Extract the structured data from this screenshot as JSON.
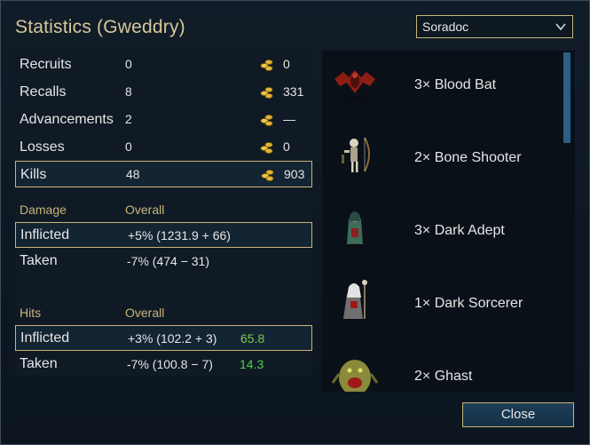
{
  "dialog": {
    "title": "Statistics (Gweddry)",
    "side_select": {
      "value": "Soradoc"
    },
    "close_label": "Close"
  },
  "summary": [
    {
      "label": "Recruits",
      "value": "0",
      "gold": "0"
    },
    {
      "label": "Recalls",
      "value": "8",
      "gold": "331"
    },
    {
      "label": "Advancements",
      "value": "2",
      "gold": "—"
    },
    {
      "label": "Losses",
      "value": "0",
      "gold": "0"
    },
    {
      "label": "Kills",
      "value": "48",
      "gold": "903"
    }
  ],
  "damage": {
    "header": "Damage",
    "column": "Overall",
    "inflicted": {
      "label": "Inflicted",
      "value": "+5% (1231.9 + 66)"
    },
    "taken": {
      "label": "Taken",
      "value": "-7% (474 − 31)"
    }
  },
  "hits": {
    "header": "Hits",
    "column": "Overall",
    "inflicted": {
      "label": "Inflicted",
      "value": "+3% (102.2 + 3)",
      "pct": "65.8"
    },
    "taken": {
      "label": "Taken",
      "value": "-7% (100.8 − 7)",
      "pct": "14.3"
    }
  },
  "units": [
    {
      "label": "3× Blood Bat",
      "icon": "blood-bat-sprite"
    },
    {
      "label": "2× Bone Shooter",
      "icon": "bone-shooter-sprite"
    },
    {
      "label": "3× Dark Adept",
      "icon": "dark-adept-sprite"
    },
    {
      "label": "1× Dark Sorcerer",
      "icon": "dark-sorcerer-sprite"
    },
    {
      "label": "2× Ghast",
      "icon": "ghast-sprite"
    }
  ],
  "colors": {
    "accent_gold": "#c9b57a",
    "title": "#d8c79a",
    "green": "#4ed14a",
    "scrollbar": "#2c5f85"
  }
}
